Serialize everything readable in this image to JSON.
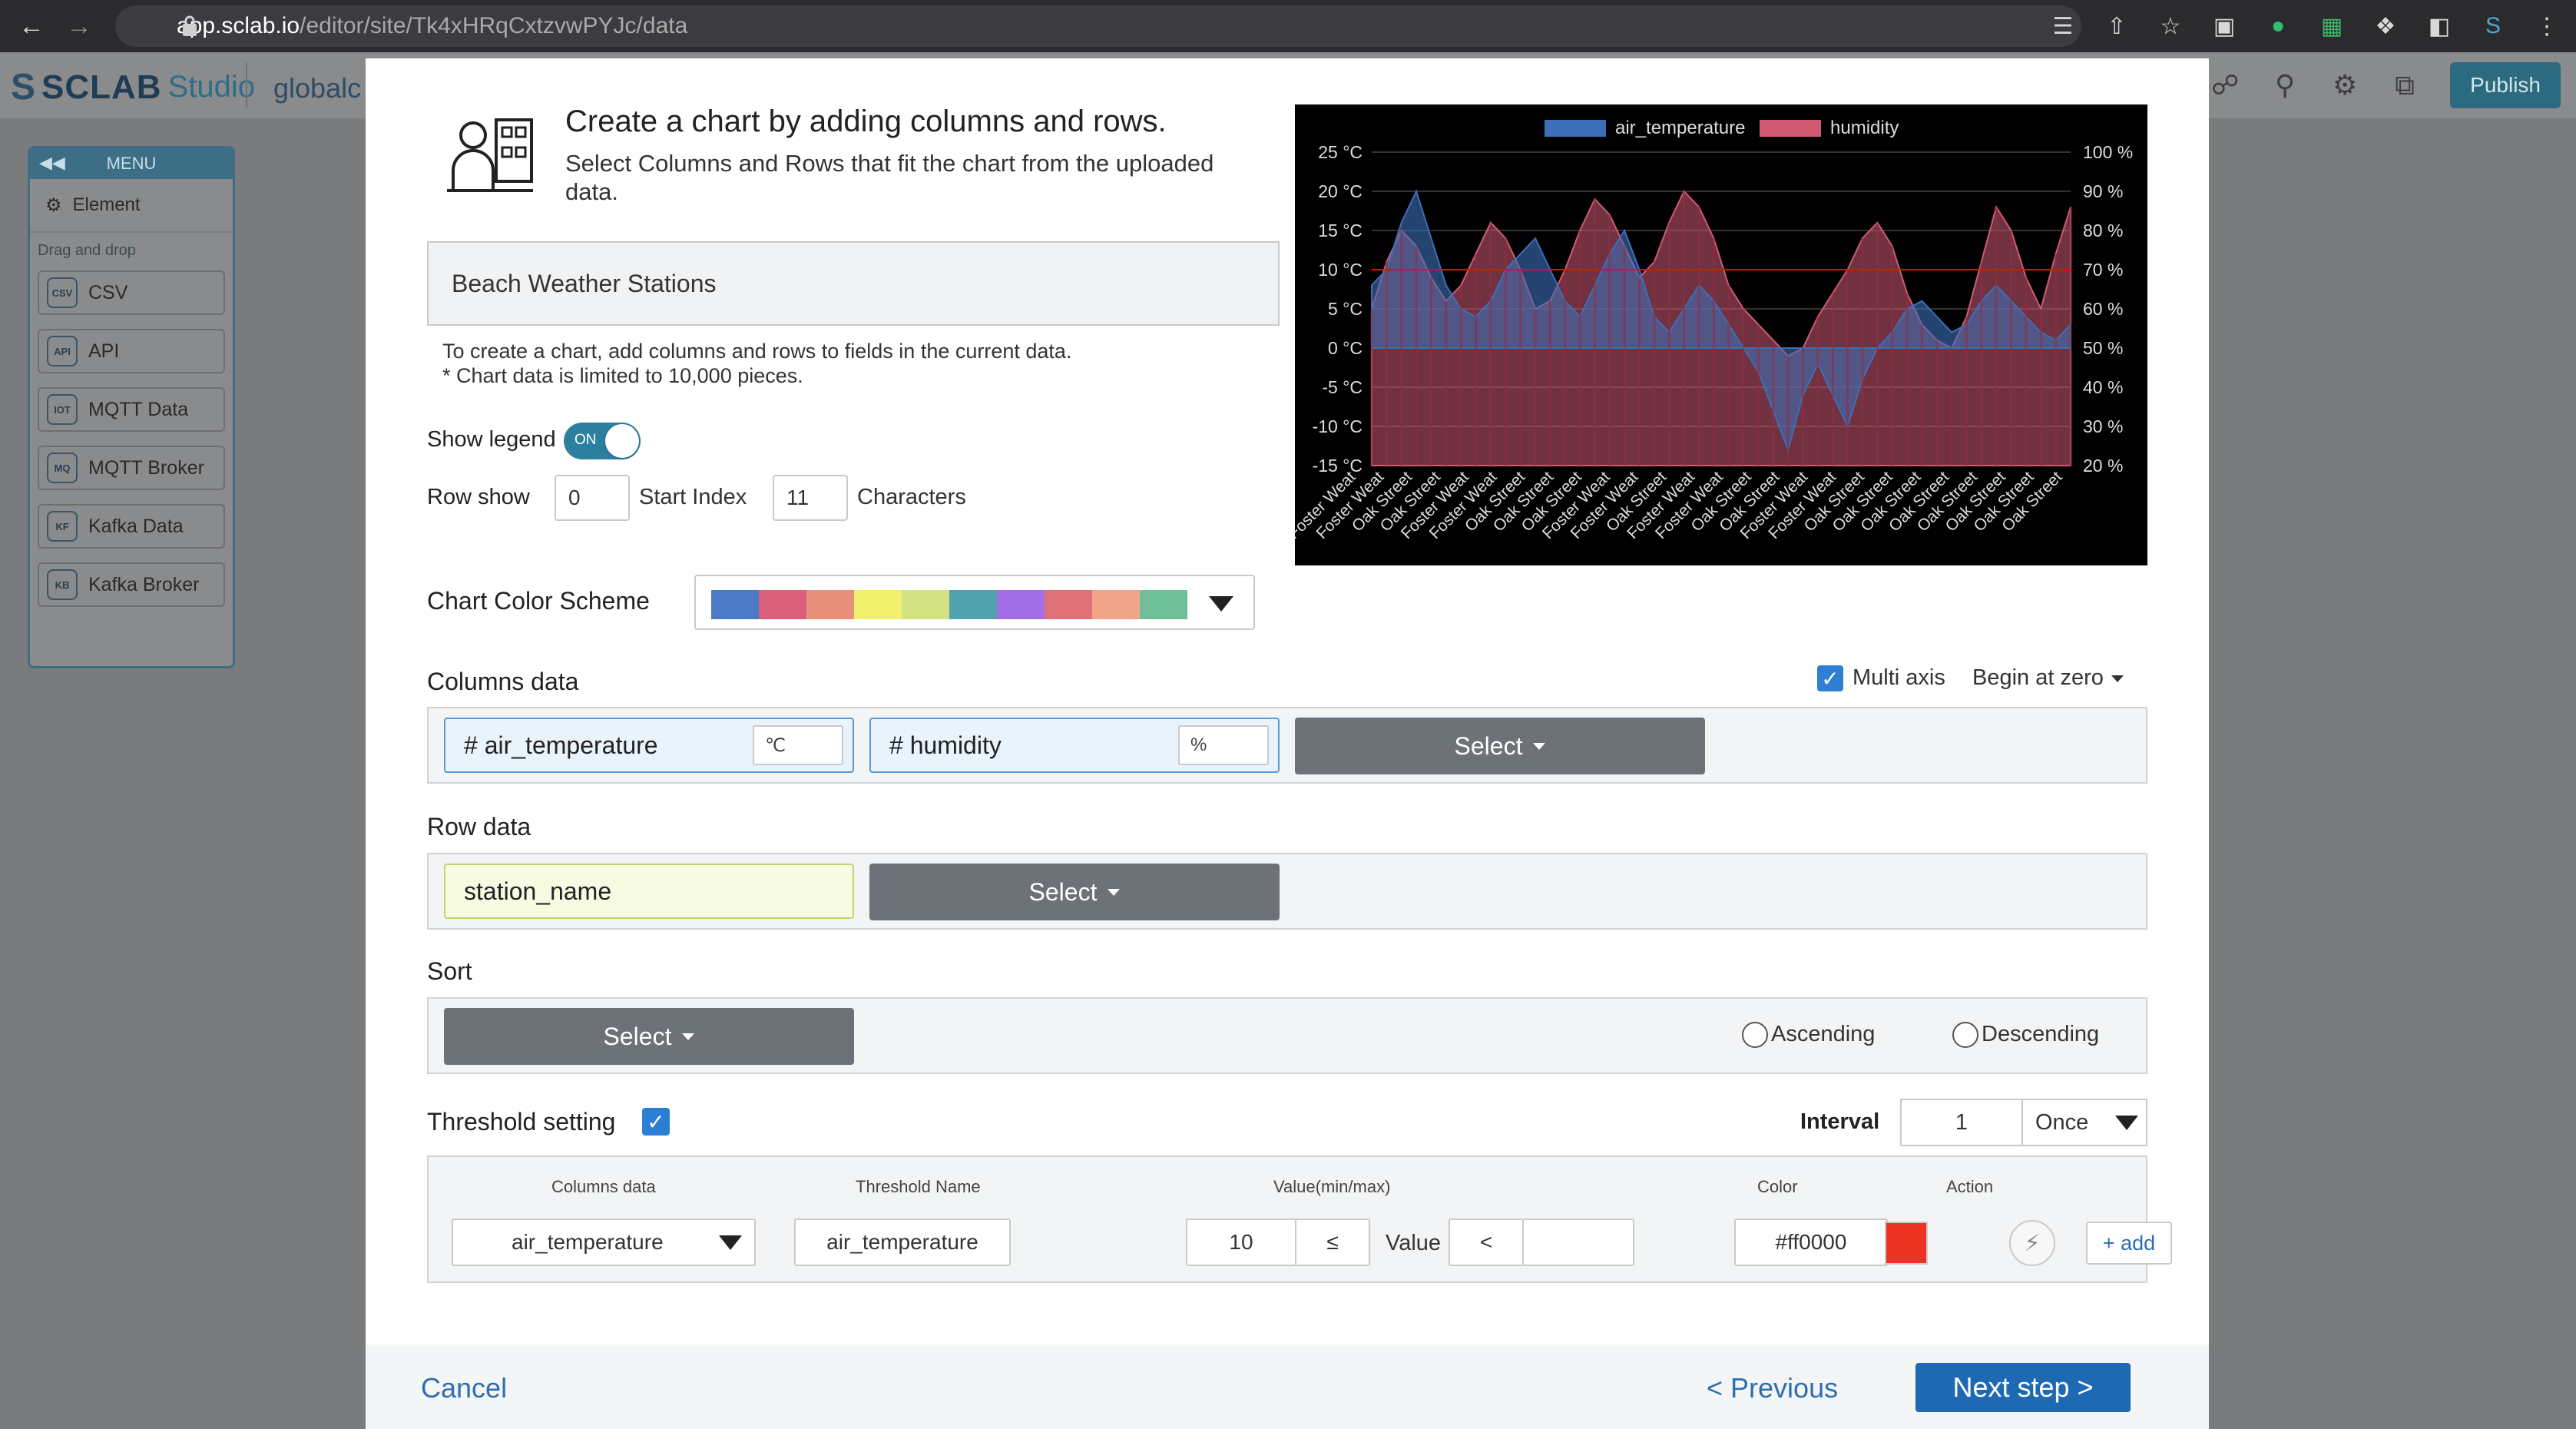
{
  "browser": {
    "url_host": "app.sclab.io",
    "url_path": "/editor/site/Tk4xHRqCxtzvwPYJc/data"
  },
  "app": {
    "brand": "SCLAB",
    "studio": "Studio",
    "site_name": "globalc",
    "publish_label": "Publish"
  },
  "menu": {
    "title": "MENU",
    "element_label": "Element",
    "drag_drop_label": "Drag and drop",
    "items": [
      {
        "label": "CSV",
        "icon": "CSV"
      },
      {
        "label": "API",
        "icon": "API"
      },
      {
        "label": "MQTT Data",
        "icon": "IOT"
      },
      {
        "label": "MQTT Broker",
        "icon": "MQ"
      },
      {
        "label": "Kafka Data",
        "icon": "KF"
      },
      {
        "label": "Kafka Broker",
        "icon": "KB"
      }
    ]
  },
  "modal": {
    "title": "Create a chart by adding columns and rows.",
    "subtitle": "Select Columns and Rows that fit the chart from the uploaded data.",
    "dataset_name": "Beach Weather Stations",
    "hint_line1": "To create a chart, add columns and rows to fields in the current data.",
    "hint_line2": "* Chart data is limited to 10,000 pieces.",
    "show_legend_label": "Show legend",
    "show_legend_state": "ON",
    "row_show_label": "Row show",
    "start_index_value": "0",
    "start_index_label": "Start Index",
    "characters_value": "11",
    "characters_label": "Characters",
    "color_scheme_label": "Chart Color Scheme",
    "color_scheme": [
      "#4a7bc4",
      "#d95f7a",
      "#e8907a",
      "#f1f06e",
      "#d3e382",
      "#52a3b0",
      "#a26ee8",
      "#e07078",
      "#eea58a",
      "#6fbf9b"
    ],
    "columns_label": "Columns data",
    "multi_axis_label": "Multi axis",
    "begin_at_zero_label": "Begin at zero",
    "columns": [
      {
        "name": "# air_temperature",
        "unit": "℃"
      },
      {
        "name": "# humidity",
        "unit": "%"
      }
    ],
    "select_label": "Select",
    "row_label": "Row data",
    "row_field": "station_name",
    "sort_label": "Sort",
    "ascending_label": "Ascending",
    "descending_label": "Descending",
    "threshold_label": "Threshold setting",
    "interval_label": "Interval",
    "interval_value": "1",
    "interval_unit": "Once",
    "threshold_headers": {
      "columns": "Columns data",
      "name": "Threshold Name",
      "value": "Value(min/max)",
      "color": "Color",
      "action": "Action"
    },
    "threshold_row": {
      "column": "air_temperature",
      "name": "air_temperature",
      "min": "10",
      "min_op": "≤",
      "value_label": "Value",
      "max_op": "<",
      "max": "",
      "color": "#ff0000",
      "add_label": "+ add"
    },
    "cancel_label": "Cancel",
    "previous_label": "< Previous",
    "next_label": "Next step >"
  },
  "chart_data": {
    "type": "area",
    "legend": [
      "air_temperature",
      "humidity"
    ],
    "legend_position": "top",
    "colors": {
      "air_temperature": "#3c6fb7",
      "humidity": "#d05a74",
      "threshold": "#ff0000"
    },
    "y_left_ticks": [
      "25 °C",
      "20 °C",
      "15 °C",
      "10 °C",
      "5 °C",
      "0 °C",
      "-5 °C",
      "-10 °C",
      "-15 °C"
    ],
    "y_right_ticks": [
      "100 %",
      "90 %",
      "80 %",
      "70 %",
      "60 %",
      "50 %",
      "40 %",
      "30 %",
      "20 %"
    ],
    "y_left_range": [
      -15,
      25
    ],
    "y_right_range": [
      20,
      100
    ],
    "x_labels": [
      "Foster Weat",
      "Foster Weat",
      "Oak Street",
      "Oak Street",
      "Foster Weat",
      "Foster Weat",
      "Oak Street",
      "Oak Street",
      "Oak Street",
      "Foster Weat",
      "Foster Weat",
      "Oak Street",
      "Foster Weat",
      "Foster Weat",
      "Oak Street",
      "Oak Street",
      "Foster Weat",
      "Foster Weat",
      "Oak Street",
      "Oak Street",
      "Oak Street",
      "Oak Street",
      "Oak Street",
      "Oak Street",
      "Oak Street",
      "Oak Street"
    ],
    "air_temperature": [
      8,
      10,
      16,
      20,
      14,
      8,
      5,
      4,
      6,
      10,
      12,
      14,
      10,
      6,
      4,
      8,
      12,
      15,
      10,
      4,
      2,
      5,
      8,
      6,
      3,
      0,
      -3,
      -8,
      -13,
      -6,
      -2,
      -6,
      -10,
      -4,
      0,
      2,
      5,
      6,
      4,
      2,
      3,
      6,
      8,
      6,
      4,
      2,
      1,
      3
    ],
    "humidity": [
      60,
      72,
      80,
      76,
      68,
      62,
      66,
      74,
      82,
      78,
      70,
      60,
      62,
      70,
      80,
      88,
      84,
      76,
      68,
      72,
      82,
      90,
      86,
      78,
      66,
      60,
      56,
      52,
      48,
      50,
      58,
      64,
      70,
      78,
      82,
      76,
      64,
      56,
      52,
      50,
      58,
      72,
      86,
      80,
      68,
      60,
      74,
      86
    ],
    "threshold_value": 10
  }
}
